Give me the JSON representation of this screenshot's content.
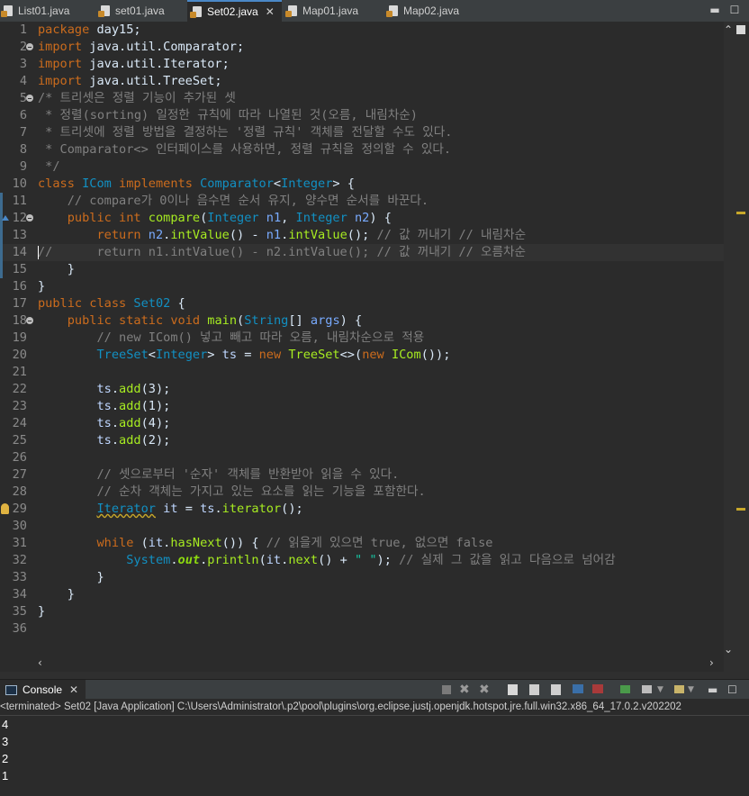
{
  "tabs": [
    {
      "label": "List01.java",
      "active": false
    },
    {
      "label": "set01.java",
      "active": false
    },
    {
      "label": "Set02.java",
      "active": true
    },
    {
      "label": "Map01.java",
      "active": false
    },
    {
      "label": "Map02.java",
      "active": false
    }
  ],
  "colors": {
    "keyword": "#cc6c1d",
    "type": "#1290c3",
    "method": "#a7ec21",
    "comment": "#808080",
    "string": "#17c6a3",
    "background": "#2b2b2b"
  },
  "editor": {
    "lines": [
      {
        "n": "1",
        "html": "<span class='kw'>package</span> day15;"
      },
      {
        "n": "2",
        "html": "<span class='kw'>import</span> java.util.Comparator;"
      },
      {
        "n": "3",
        "html": "<span class='kw'>import</span> java.util.Iterator;"
      },
      {
        "n": "4",
        "html": "<span class='kw'>import</span> java.util.TreeSet;"
      },
      {
        "n": "5",
        "html": "<span class='cm'>/* 트리셋은 정렬 기능이 추가된 셋</span>"
      },
      {
        "n": "6",
        "html": "<span class='cm'> * 정렬(sorting) 일정한 규칙에 따라 나열된 것(오름, 내림차순)</span>"
      },
      {
        "n": "7",
        "html": "<span class='cm'> * 트리셋에 정렬 방법을 결정하는 '정렬 규칙' 객체를 전달할 수도 있다.</span>"
      },
      {
        "n": "8",
        "html": "<span class='cm'> * Comparator&lt;&gt; 인터페이스를 사용하면, 정렬 규칙을 정의할 수 있다.</span>"
      },
      {
        "n": "9",
        "html": "<span class='cm'> */</span>"
      },
      {
        "n": "10",
        "html": "<span class='kw'>class</span> <span class='typ'>ICom</span> <span class='kw'>implements</span> <span class='typ'>Comparator</span>&lt;<span class='typ'>Integer</span>&gt; {"
      },
      {
        "n": "11",
        "html": "    <span class='cm'>// compare가 0이나 음수면 순서 유지, 양수면 순서를 바꾼다.</span>"
      },
      {
        "n": "12",
        "html": "    <span class='kw'>public</span> <span class='kw'>int</span> <span class='fn'>compare</span>(<span class='typ'>Integer</span> <span class='var'>n1</span>, <span class='typ'>Integer</span> <span class='var'>n2</span>) {"
      },
      {
        "n": "13",
        "html": "        <span class='kw'>return</span> <span class='var'>n2</span>.<span class='fn'>intValue</span>() - <span class='var'>n1</span>.<span class='fn'>intValue</span>(); <span class='cm'>// 값 꺼내기 // 내림차순</span>"
      },
      {
        "n": "14",
        "html": "<span class='cm'>//      return n1.intValue() - n2.intValue(); // 값 꺼내기 // 오름차순</span>"
      },
      {
        "n": "15",
        "html": "    }"
      },
      {
        "n": "16",
        "html": "}"
      },
      {
        "n": "17",
        "html": "<span class='kw'>public</span> <span class='kw'>class</span> <span class='typ'>Set02</span> {"
      },
      {
        "n": "18",
        "html": "    <span class='kw'>public</span> <span class='kw'>static</span> <span class='kw'>void</span> <span class='fn'>main</span>(<span class='typ'>String</span>[] <span class='var'>args</span>) {"
      },
      {
        "n": "19",
        "html": "        <span class='cm'>// new ICom() 넣고 빼고 따라 오름, 내림차순으로 적용</span>"
      },
      {
        "n": "20",
        "html": "        <span class='typ'>TreeSet</span>&lt;<span class='typ'>Integer</span>&gt; <span class='gen'>ts</span> = <span class='kw'>new</span> <span class='fn'>TreeSet</span>&lt;&gt;(<span class='kw'>new</span> <span class='fn'>ICom</span>());"
      },
      {
        "n": "21",
        "html": ""
      },
      {
        "n": "22",
        "html": "        <span class='gen'>ts</span>.<span class='fn'>add</span>(3);"
      },
      {
        "n": "23",
        "html": "        <span class='gen'>ts</span>.<span class='fn'>add</span>(1);"
      },
      {
        "n": "24",
        "html": "        <span class='gen'>ts</span>.<span class='fn'>add</span>(4);"
      },
      {
        "n": "25",
        "html": "        <span class='gen'>ts</span>.<span class='fn'>add</span>(2);"
      },
      {
        "n": "26",
        "html": ""
      },
      {
        "n": "27",
        "html": "        <span class='cm'>// 셋으로부터 '순자' 객체를 반환받아 읽을 수 있다.</span>"
      },
      {
        "n": "28",
        "html": "        <span class='cm'>// 순차 객체는 가지고 있는 요소를 읽는 기능을 포함한다.</span>"
      },
      {
        "n": "29",
        "html": "        <span class='typ under'>Iterator</span> <span class='gen'>it</span> = <span class='gen'>ts</span>.<span class='fn'>iterator</span>();"
      },
      {
        "n": "30",
        "html": ""
      },
      {
        "n": "31",
        "html": "        <span class='kw'>while</span> (<span class='gen'>it</span>.<span class='fn'>hasNext</span>()) { <span class='cm'>// 읽을게 있으면 true, 없으면 false</span>"
      },
      {
        "n": "32",
        "html": "            <span class='typ'>System</span>.<span class='fld'>out</span>.<span class='fn'>println</span>(<span class='gen'>it</span>.<span class='fn'>next</span>() + <span class='str'>\" \"</span>); <span class='cm'>// 실제 그 값을 읽고 다음으로 넘어감</span>"
      },
      {
        "n": "33",
        "html": "        }"
      },
      {
        "n": "34",
        "html": "    }"
      },
      {
        "n": "35",
        "html": "}"
      },
      {
        "n": "36",
        "html": ""
      }
    ],
    "current_line": "14",
    "fold_lines": [
      "2",
      "5",
      "12",
      "18"
    ]
  },
  "console": {
    "tab_label": "Console",
    "status": "<terminated> Set02 [Java Application] C:\\Users\\Administrator\\.p2\\pool\\plugins\\org.eclipse.justj.openjdk.hotspot.jre.full.win32.x86_64_17.0.2.v202202",
    "output": [
      "4",
      "3",
      "2",
      "1"
    ]
  }
}
